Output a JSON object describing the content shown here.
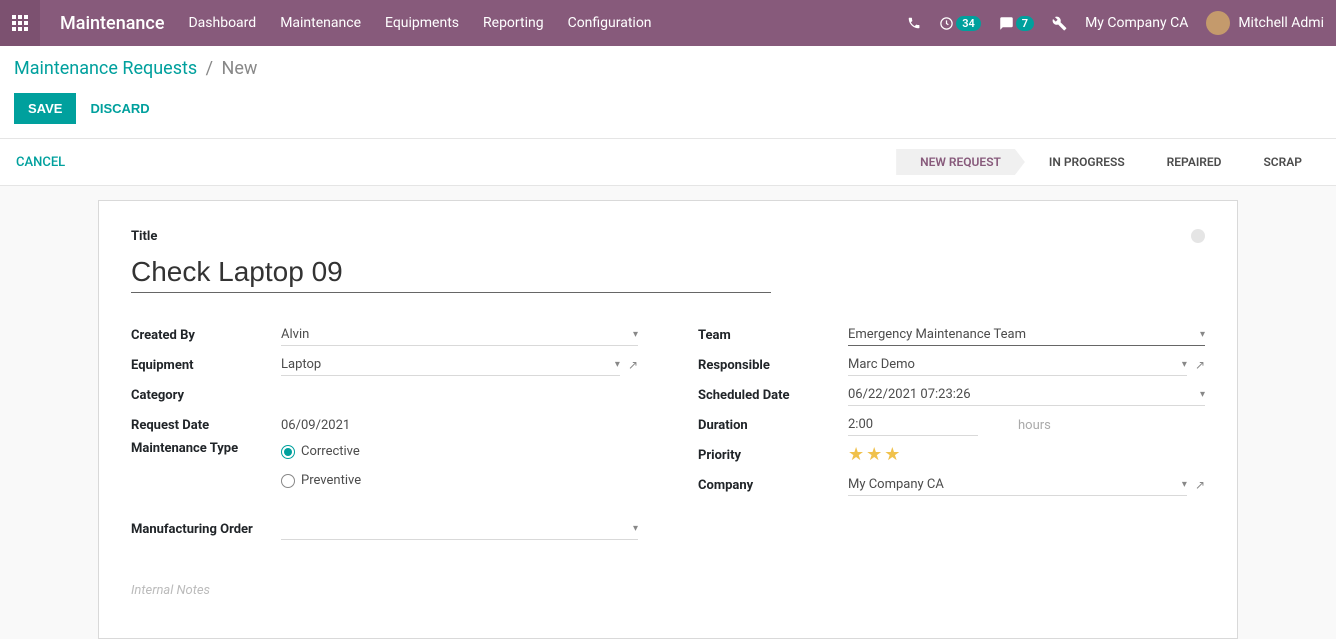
{
  "topbar": {
    "brand": "Maintenance",
    "nav": [
      "Dashboard",
      "Maintenance",
      "Equipments",
      "Reporting",
      "Configuration"
    ],
    "clock_badge": "34",
    "msg_badge": "7",
    "company": "My Company CA",
    "user": "Mitchell Admi"
  },
  "breadcrumb": {
    "parent": "Maintenance Requests",
    "sep": "/",
    "current": "New"
  },
  "buttons": {
    "save": "SAVE",
    "discard": "DISCARD",
    "cancel": "CANCEL"
  },
  "stages": [
    "NEW REQUEST",
    "IN PROGRESS",
    "REPAIRED",
    "SCRAP"
  ],
  "form": {
    "title_label": "Title",
    "title_value": "Check Laptop 09",
    "left": {
      "created_by_label": "Created By",
      "created_by": "Alvin",
      "equipment_label": "Equipment",
      "equipment": "Laptop",
      "category_label": "Category",
      "request_date_label": "Request Date",
      "request_date": "06/09/2021",
      "maintenance_type_label": "Maintenance Type",
      "corrective": "Corrective",
      "preventive": "Preventive",
      "mo_label": "Manufacturing Order"
    },
    "right": {
      "team_label": "Team",
      "team": "Emergency Maintenance Team",
      "responsible_label": "Responsible",
      "responsible": "Marc Demo",
      "scheduled_label": "Scheduled Date",
      "scheduled": "06/22/2021 07:23:26",
      "duration_label": "Duration",
      "duration": "2:00",
      "hours": "hours",
      "priority_label": "Priority",
      "company_label": "Company",
      "company": "My Company CA"
    },
    "notes_placeholder": "Internal Notes"
  }
}
